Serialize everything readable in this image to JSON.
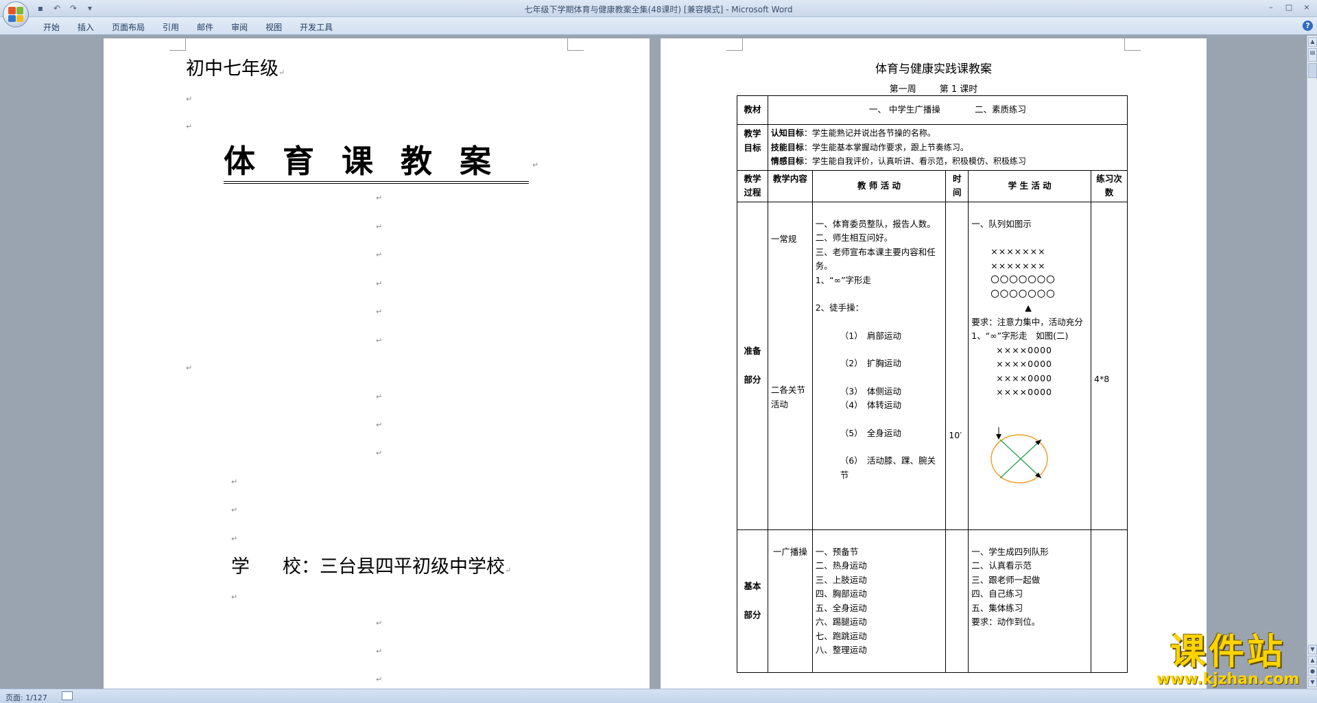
{
  "window": {
    "title": "七年级下学期体育与健康教案全集(48课时) [兼容模式] - Microsoft Word",
    "controls": [
      "–",
      "□",
      "×"
    ]
  },
  "quick_access": [
    {
      "icon": "save-icon",
      "glyph": "▪"
    },
    {
      "icon": "undo-icon",
      "glyph": "↶"
    },
    {
      "icon": "redo-icon",
      "glyph": "↷"
    },
    {
      "icon": "customize-icon",
      "glyph": "▾"
    }
  ],
  "ribbon_tabs": [
    "开始",
    "插入",
    "页面布局",
    "引用",
    "邮件",
    "审阅",
    "视图",
    "开发工具"
  ],
  "help_glyph": "?",
  "page1": {
    "grade": "初中七年级",
    "title": "体育课教案",
    "school_label": "学",
    "school_label2": "校：",
    "school_name": "三台县四平初级中学校",
    "para_mark": "↵"
  },
  "page2": {
    "title": "体育与健康实践课教案",
    "week": "第一周",
    "lesson": "第 1 课时",
    "material_label": "教材",
    "material_items": [
      "一、 中学生广播操",
      "二、素质练习"
    ],
    "objectives_label": "教学目标",
    "objectives": [
      {
        "label": "认知目标",
        "text": "：学生能熟记并说出各节操的名称。"
      },
      {
        "label": "技能目标",
        "text": "：学生能基本掌握动作要求，跟上节奏练习。"
      },
      {
        "label": "情感目标",
        "text": "：学生能自我评价，认真听讲、看示范，积极模仿、积极练习"
      }
    ],
    "headers": {
      "process": "教学过程",
      "content": "教学内容",
      "teacher": "教 师 活 动",
      "time": "时间",
      "student": "学 生 活 动",
      "count": "练习次数"
    },
    "prep": {
      "section": "准备部分",
      "content1": "一常规",
      "content2": "二各关节活动",
      "teacher": [
        "一、体育委员整队，报告人数。",
        "二、师生相互问好。",
        "三、老师宣布本课主要内容和任务。",
        "1、“∞”字形走",
        "2、徒手操：",
        "（1）　肩部运动",
        "（2）　扩胸运动",
        "（3）　体侧运动",
        "（4）　体转运动",
        "（5）　全身运动",
        "（6）　活动膝、踝、腕关节"
      ],
      "time": "10′",
      "student": [
        "一、队列如图示",
        "×××××××",
        "×××××××",
        "〇〇〇〇〇〇〇",
        "〇〇〇〇〇〇〇",
        "▲",
        "要求：注意力集中，活动充分",
        "1、“∞”字形走　如图(二)",
        "××××0000",
        "××××0000",
        "××××0000",
        "××××0000"
      ],
      "count": "4*8"
    },
    "basic": {
      "section": "基本部分",
      "content": "一广播操",
      "teacher": [
        "一、预备节",
        "二、热身运动",
        "三、上肢运动",
        "四、胸部运动",
        "五、全身运动",
        "六、踢腿运动",
        "七、跑跳运动",
        "八、整理运动"
      ],
      "student": [
        "一、学生成四列队形",
        "二、认真看示范",
        "三、跟老师一起做",
        "四、自己练习",
        "五、集体练习",
        "要求：动作到位。"
      ]
    }
  },
  "status": {
    "page": "页面: 1/127"
  },
  "watermark": {
    "main": "课件站",
    "url": "www.kjzhan.com"
  }
}
